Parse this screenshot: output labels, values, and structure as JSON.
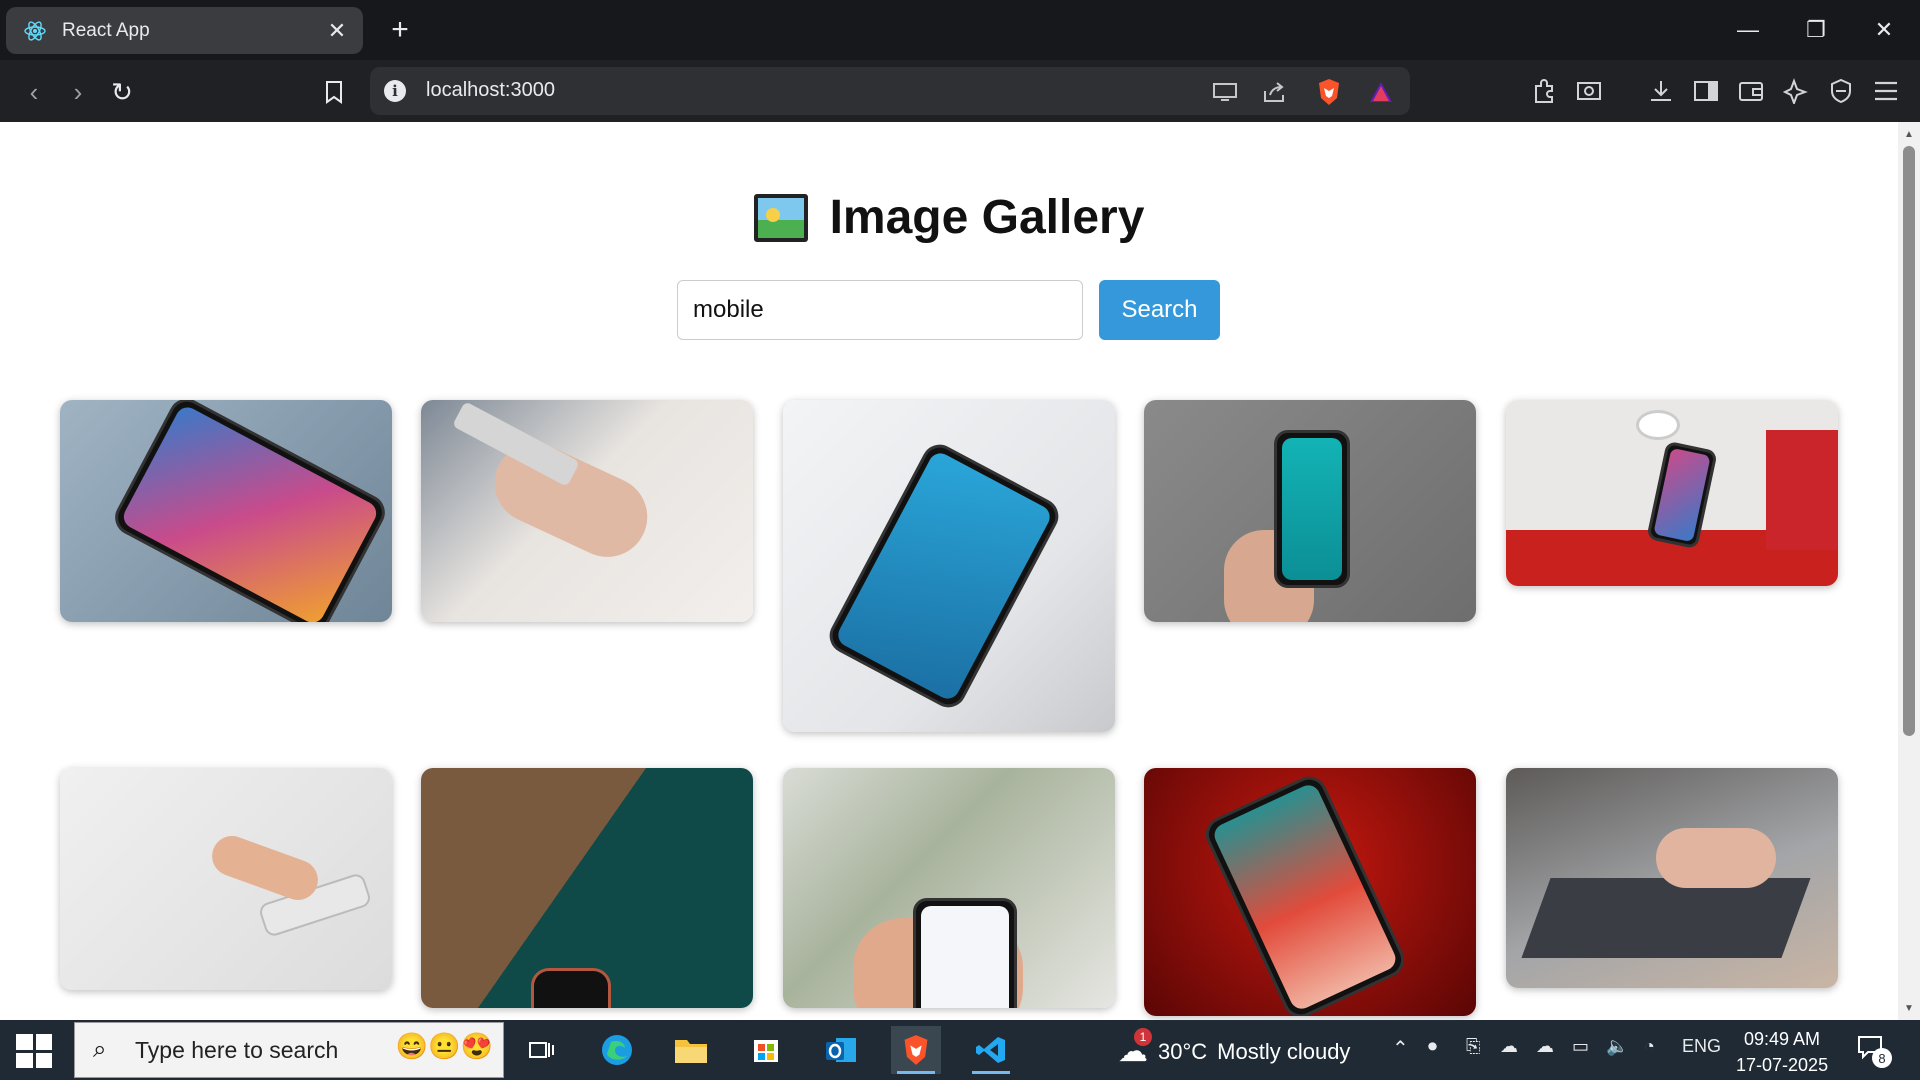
{
  "browser": {
    "tab_title": "React App",
    "url": "localhost:3000",
    "tab_close": "✕",
    "new_tab": "+"
  },
  "page": {
    "heading": "Image Gallery",
    "search_value": "mobile",
    "search_button": "Search"
  },
  "gallery": {
    "images": [
      {
        "subject": "smartphone-home-screen-on-table"
      },
      {
        "subject": "hands-holding-phone-with-watch"
      },
      {
        "subject": "phone-on-laptop-top-view"
      },
      {
        "subject": "hand-holding-phone-coinview"
      },
      {
        "subject": "hands-holding-phone-at-desk"
      },
      {
        "subject": "man-using-white-phone"
      },
      {
        "subject": "phone-on-wooden-table-teal"
      },
      {
        "subject": "hand-holding-phone-plants"
      },
      {
        "subject": "phone-on-red-background"
      },
      {
        "subject": "hands-with-phone-over-laptop"
      }
    ]
  },
  "taskbar": {
    "search_placeholder": "Type here to search",
    "weather_temp": "30°C",
    "weather_text": "Mostly cloudy",
    "weather_badge": "1",
    "language": "ENG",
    "time": "09:49 AM",
    "date": "17-07-2025",
    "notification_count": "8"
  },
  "colors": {
    "search_button": "#3498db",
    "taskbar": "#1f2a35",
    "browser_frame": "#202124"
  }
}
